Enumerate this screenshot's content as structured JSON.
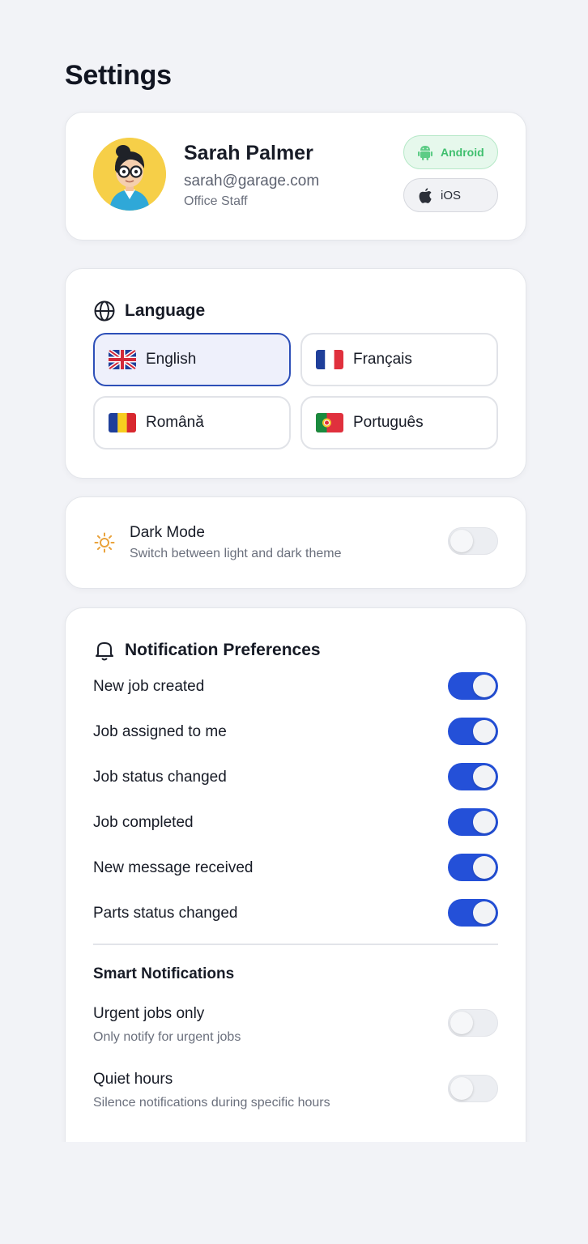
{
  "page": {
    "title": "Settings"
  },
  "profile": {
    "name": "Sarah Palmer",
    "email": "sarah@garage.com",
    "role": "Office Staff",
    "avatar_icon": "avatar-illustration",
    "platforms": [
      {
        "label": "Android",
        "icon": "android-icon",
        "selected": true
      },
      {
        "label": "iOS",
        "icon": "apple-icon",
        "selected": false
      }
    ]
  },
  "language": {
    "title": "Language",
    "icon": "globe-icon",
    "options": [
      {
        "label": "English",
        "flag": "uk-flag-icon",
        "selected": true
      },
      {
        "label": "Français",
        "flag": "france-flag-icon",
        "selected": false
      },
      {
        "label": "Română",
        "flag": "romania-flag-icon",
        "selected": false
      },
      {
        "label": "Português",
        "flag": "portugal-flag-icon",
        "selected": false
      }
    ]
  },
  "dark_mode": {
    "title": "Dark Mode",
    "subtitle": "Switch between light and dark theme",
    "icon": "sun-icon",
    "enabled": false
  },
  "notifications": {
    "title": "Notification Preferences",
    "icon": "bell-icon",
    "items": [
      {
        "label": "New job created",
        "enabled": true
      },
      {
        "label": "Job assigned to me",
        "enabled": true
      },
      {
        "label": "Job status changed",
        "enabled": true
      },
      {
        "label": "Job completed",
        "enabled": true
      },
      {
        "label": "New message received",
        "enabled": true
      },
      {
        "label": "Parts status changed",
        "enabled": true
      }
    ],
    "smart": {
      "title": "Smart Notifications",
      "items": [
        {
          "label": "Urgent jobs only",
          "subtitle": "Only notify for urgent jobs",
          "enabled": false
        },
        {
          "label": "Quiet hours",
          "subtitle": "Silence notifications during specific hours",
          "enabled": false
        }
      ]
    }
  },
  "colors": {
    "accent": "#2450d8",
    "selected_border": "#2d4fb8",
    "android_green": "#3fbf6e",
    "background": "#f2f3f7"
  }
}
